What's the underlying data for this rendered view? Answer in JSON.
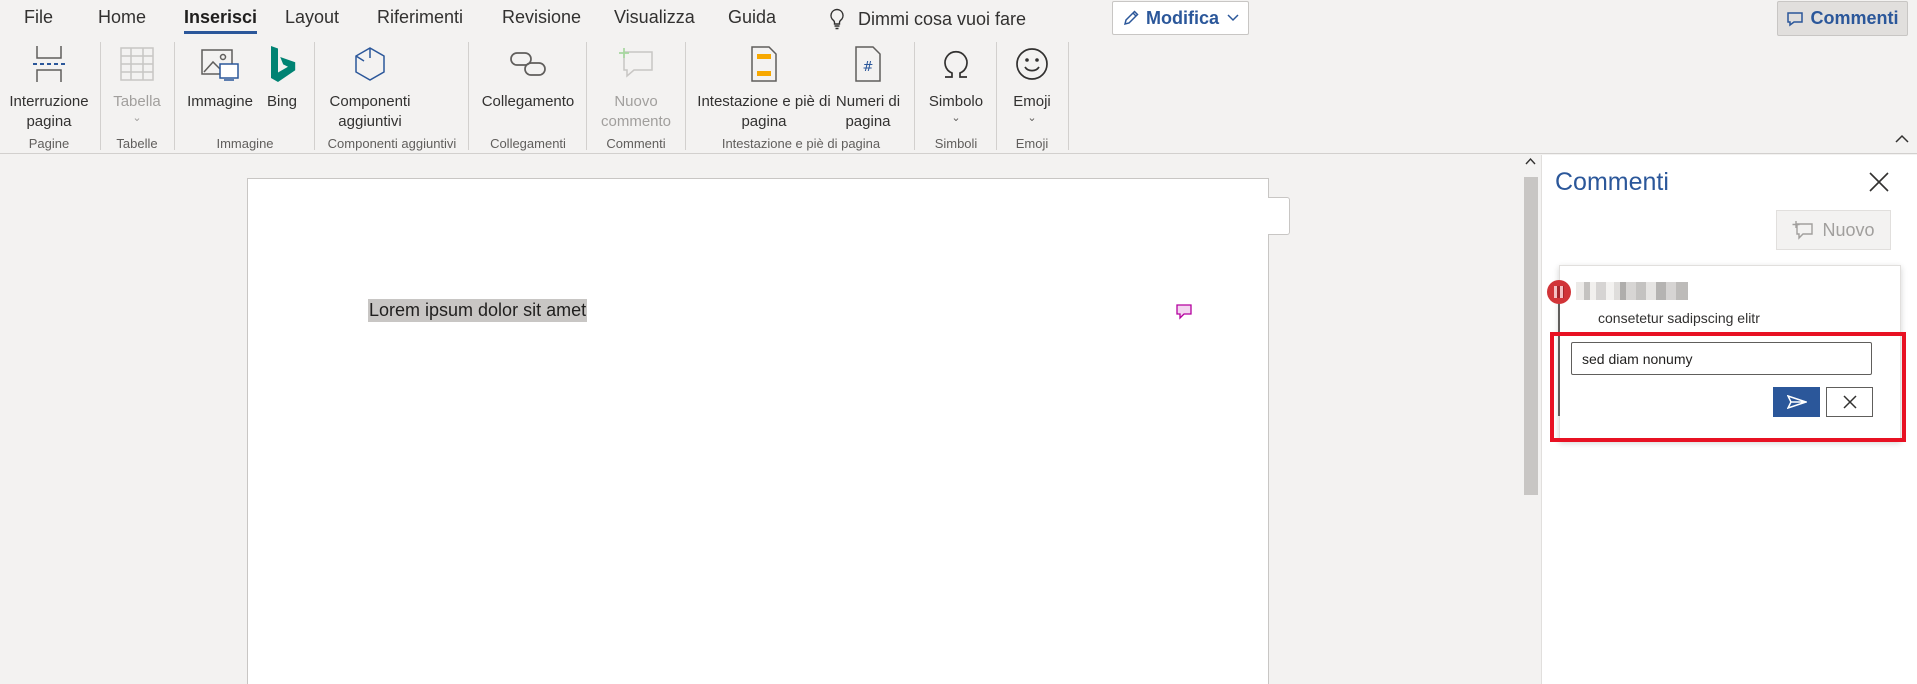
{
  "menu": {
    "tabs": [
      {
        "label": "File"
      },
      {
        "label": "Home"
      },
      {
        "label": "Inserisci"
      },
      {
        "label": "Layout"
      },
      {
        "label": "Riferimenti"
      },
      {
        "label": "Revisione"
      },
      {
        "label": "Visualizza"
      },
      {
        "label": "Guida"
      }
    ],
    "active_tab": "Inserisci",
    "tell_me": "Dimmi cosa vuoi fare",
    "edit_mode_label": "Modifica",
    "comments_label": "Commenti"
  },
  "ribbon": {
    "buttons": {
      "page_break": "Interruzione pagina",
      "table": "Tabella",
      "image": "Immagine",
      "bing": "Bing",
      "addins": "Componenti aggiuntivi",
      "link": "Collegamento",
      "new_comment": "Nuovo commento",
      "header_footer": "Intestazione e piè di pagina",
      "page_numbers": "Numeri di pagina",
      "symbol": "Simbolo",
      "emoji": "Emoji"
    },
    "groups": {
      "pages": "Pagine",
      "tables": "Tabelle",
      "image": "Immagine",
      "addins": "Componenti aggiuntivi",
      "links": "Collegamenti",
      "comments": "Commenti",
      "header_footer": "Intestazione e piè di pagina",
      "symbols": "Simboli",
      "emoji": "Emoji"
    }
  },
  "document": {
    "text": "Lorem ipsum dolor sit amet"
  },
  "comments_pane": {
    "title": "Commenti",
    "new_label": "Nuovo",
    "comment": {
      "body": "consetetur sadipscing elitr"
    },
    "reply": {
      "value": "sed diam nonumy"
    }
  },
  "colors": {
    "accent": "#2b579a",
    "highlight": "#e81123",
    "comment_marker": "#b4009e"
  }
}
